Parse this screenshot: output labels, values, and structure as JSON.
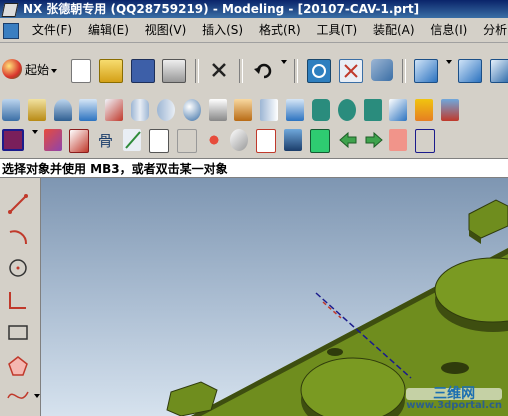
{
  "window": {
    "app": "NX",
    "title_rest": "张德朝专用 (QQ28759219) - Modeling - [20107-CAV-1.prt]"
  },
  "menubar": {
    "items": [
      {
        "label": "文件(F)"
      },
      {
        "label": "编辑(E)"
      },
      {
        "label": "视图(V)"
      },
      {
        "label": "插入(S)"
      },
      {
        "label": "格式(R)"
      },
      {
        "label": "工具(T)"
      },
      {
        "label": "装配(A)"
      },
      {
        "label": "信息(I)"
      },
      {
        "label": "分析(L)"
      }
    ]
  },
  "toolbar": {
    "start_label": "起始"
  },
  "status": {
    "prompt": "选择对象并使用 MB3，或者双击某一对象"
  },
  "watermark": {
    "line1": "三维网",
    "line2": "www.3dportal.cn"
  },
  "colors": {
    "model_green": "#6f8d1e",
    "model_dark": "#3e4e10",
    "title_blue": "#0a246a",
    "viewport_top": "#7e96b2"
  }
}
